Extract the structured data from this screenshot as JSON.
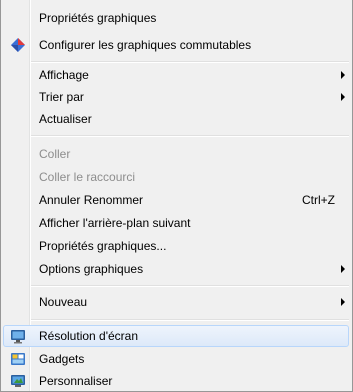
{
  "menu": {
    "items": [
      {
        "label": "Propriétés graphiques"
      },
      {
        "label": "Configurer les graphiques commutables",
        "icon": "graphics-diamond-icon"
      },
      {
        "label": "Affichage",
        "submenu": true
      },
      {
        "label": "Trier par",
        "submenu": true
      },
      {
        "label": "Actualiser"
      },
      {
        "label": "Coller",
        "disabled": true
      },
      {
        "label": "Coller le raccourci",
        "disabled": true
      },
      {
        "label": "Annuler Renommer",
        "shortcut": "Ctrl+Z"
      },
      {
        "label": "Afficher l'arrière-plan suivant"
      },
      {
        "label": "Propriétés graphiques..."
      },
      {
        "label": "Options graphiques",
        "submenu": true
      },
      {
        "label": "Nouveau",
        "submenu": true
      },
      {
        "label": "Résolution d'écran",
        "icon": "monitor-icon",
        "highlighted": true
      },
      {
        "label": "Gadgets",
        "icon": "gadgets-icon"
      },
      {
        "label": "Personnaliser",
        "icon": "personalize-icon"
      }
    ]
  },
  "colors": {
    "menu_background": "#f0f0f0",
    "disabled_text": "#8d8d8d",
    "highlight_border": "#b8d6fb"
  }
}
